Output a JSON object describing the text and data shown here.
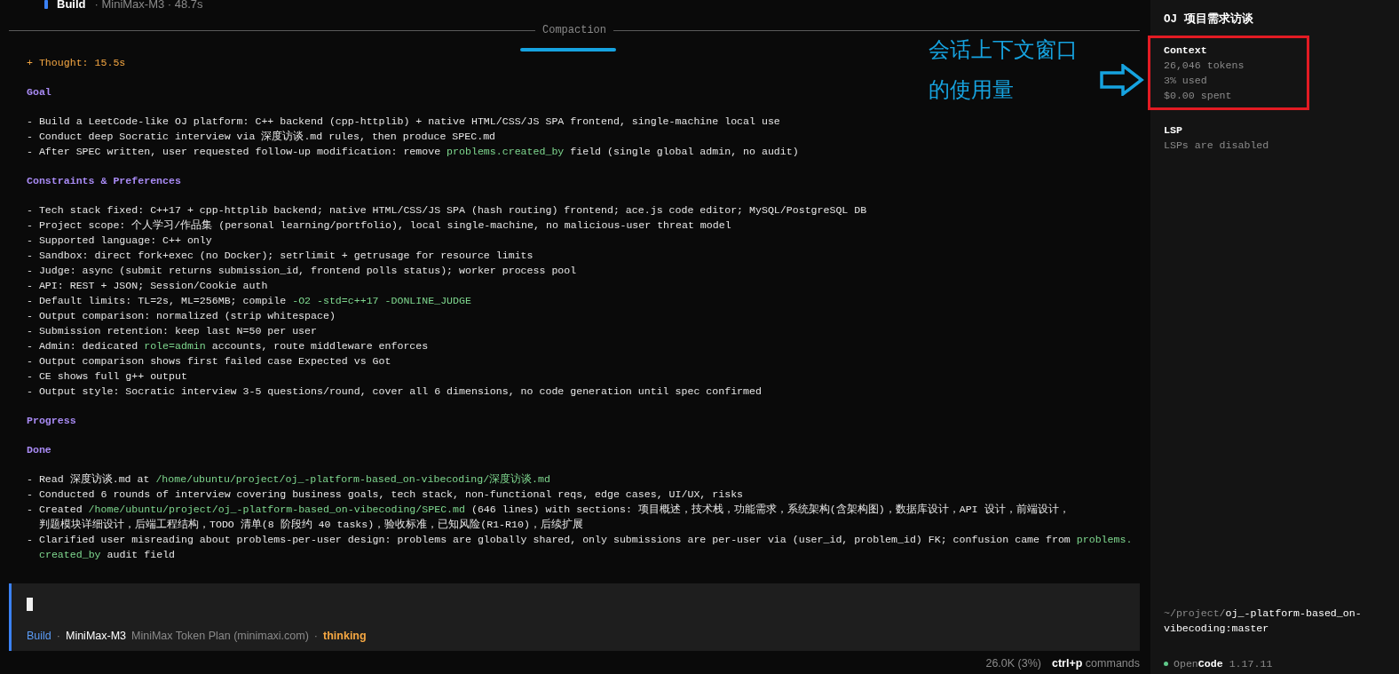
{
  "header": {
    "agent": "Build",
    "detail": "· MiniMax-M3 · 48.7s"
  },
  "divider_label": "Compaction",
  "blocks": [
    {
      "kind": "thought",
      "text": "+ Thought: 15.5s"
    },
    {
      "kind": "heading",
      "text": "Goal"
    },
    {
      "kind": "bullets",
      "items": [
        {
          "lines": [
            [
              {
                "kind": "plain",
                "text": "- Build a LeetCode-like OJ platform: C++ backend (cpp-httplib) + native HTML/CSS/JS SPA frontend, single-machine local use"
              }
            ]
          ]
        },
        {
          "lines": [
            [
              {
                "kind": "plain",
                "text": "- Conduct deep Socratic interview via 深度访谈.md rules, then produce SPEC.md"
              }
            ]
          ]
        },
        {
          "lines": [
            [
              {
                "kind": "plain",
                "text": "- After SPEC written, user requested follow-up modification: remove "
              },
              {
                "kind": "code",
                "text": "problems.created_by"
              },
              {
                "kind": "plain",
                "text": " field (single global admin, no audit)"
              }
            ]
          ]
        }
      ]
    },
    {
      "kind": "heading",
      "text": "Constraints & Preferences"
    },
    {
      "kind": "bullets",
      "items": [
        {
          "lines": [
            [
              {
                "kind": "plain",
                "text": "- Tech stack fixed: C++17 + cpp-httplib backend; native HTML/CSS/JS SPA (hash routing) frontend; ace.js code editor; MySQL/PostgreSQL DB"
              }
            ]
          ]
        },
        {
          "lines": [
            [
              {
                "kind": "plain",
                "text": "- Project scope: 个人学习/作品集 (personal learning/portfolio), local single-machine, no malicious-user threat model"
              }
            ]
          ]
        },
        {
          "lines": [
            [
              {
                "kind": "plain",
                "text": "- Supported language: C++ only"
              }
            ]
          ]
        },
        {
          "lines": [
            [
              {
                "kind": "plain",
                "text": "- Sandbox: direct fork+exec (no Docker); setrlimit + getrusage for resource limits"
              }
            ]
          ]
        },
        {
          "lines": [
            [
              {
                "kind": "plain",
                "text": "- Judge: async (submit returns submission_id, frontend polls status); worker process pool"
              }
            ]
          ]
        },
        {
          "lines": [
            [
              {
                "kind": "plain",
                "text": "- API: REST + JSON; Session/Cookie auth"
              }
            ]
          ]
        },
        {
          "lines": [
            [
              {
                "kind": "plain",
                "text": "- Default limits: TL=2s, ML=256MB; compile "
              },
              {
                "kind": "code",
                "text": "-O2 -std=c++17 -DONLINE_JUDGE"
              }
            ]
          ]
        },
        {
          "lines": [
            [
              {
                "kind": "plain",
                "text": "- Output comparison: normalized (strip whitespace)"
              }
            ]
          ]
        },
        {
          "lines": [
            [
              {
                "kind": "plain",
                "text": "- Submission retention: keep last N=50 per user"
              }
            ]
          ]
        },
        {
          "lines": [
            [
              {
                "kind": "plain",
                "text": "- Admin: dedicated "
              },
              {
                "kind": "code",
                "text": "role=admin"
              },
              {
                "kind": "plain",
                "text": " accounts, route middleware enforces"
              }
            ]
          ]
        },
        {
          "lines": [
            [
              {
                "kind": "plain",
                "text": "- Output comparison shows first failed case Expected vs Got"
              }
            ]
          ]
        },
        {
          "lines": [
            [
              {
                "kind": "plain",
                "text": "- CE shows full g++ output"
              }
            ]
          ]
        },
        {
          "lines": [
            [
              {
                "kind": "plain",
                "text": "- Output style: Socratic interview 3-5 questions/round, cover all 6 dimensions, no code generation until spec confirmed"
              }
            ]
          ]
        }
      ]
    },
    {
      "kind": "heading",
      "text": "Progress"
    },
    {
      "kind": "heading",
      "text": "Done"
    },
    {
      "kind": "bullets",
      "items": [
        {
          "lines": [
            [
              {
                "kind": "plain",
                "text": "- Read 深度访谈.md at "
              },
              {
                "kind": "code",
                "text": "/home/ubuntu/project/oj_-platform-based_on-vibecoding/深度访谈.md"
              }
            ]
          ]
        },
        {
          "lines": [
            [
              {
                "kind": "plain",
                "text": "- Conducted 6 rounds of interview covering business goals, tech stack, non-functional reqs, edge cases, UI/UX, risks"
              }
            ]
          ]
        },
        {
          "lines": [
            [
              {
                "kind": "plain",
                "text": "- Created "
              },
              {
                "kind": "code",
                "text": "/home/ubuntu/project/oj_-platform-based_on-vibecoding/SPEC.md"
              },
              {
                "kind": "plain",
                "text": " (646 lines) with sections: 项目概述，技术栈，功能需求，系统架构(含架构图)，数据库设计，API 设计，前端设计，"
              }
            ],
            [
              {
                "kind": "plain",
                "text": "判题模块详细设计，后端工程结构，TODO 清单(8 阶段约 40 tasks)，验收标准，已知风险(R1-R10)，后续扩展"
              }
            ]
          ]
        },
        {
          "lines": [
            [
              {
                "kind": "plain",
                "text": "- Clarified user misreading about problems-per-user design: problems are globally shared, only submissions are per-user via (user_id, problem_id) FK; confusion came from "
              },
              {
                "kind": "code",
                "text": "problems."
              }
            ],
            [
              {
                "kind": "code",
                "text": "created_by"
              },
              {
                "kind": "plain",
                "text": " audit field"
              }
            ]
          ]
        }
      ]
    }
  ],
  "input": {
    "mode": "Build",
    "sep1": "·",
    "model": "MiniMax-M3",
    "provider": "MiniMax Token Plan (minimaxi.com)",
    "sep2": "·",
    "status": "thinking"
  },
  "status_bar": {
    "usage": "26.0K (3%)",
    "shortcut": "ctrl+p",
    "shortcut_label": "commands"
  },
  "sidebar": {
    "title": "OJ 项目需求访谈",
    "sections": [
      {
        "heading": "Context",
        "lines": [
          "26,046 tokens",
          "3% used",
          "$0.00 spent"
        ],
        "highlighted": true
      },
      {
        "heading": "LSP",
        "lines": [
          "LSPs are disabled"
        ],
        "highlighted": false
      }
    ],
    "path_prefix": "~/project/",
    "path_lines": [
      "oj_-platform-based_on-",
      "vibecoding:master"
    ],
    "version": {
      "name_dim": "Open",
      "name_bold": "Code",
      "number": "1.17.11"
    }
  },
  "annotation": {
    "lines": [
      "会话上下文窗口",
      "的使用量"
    ]
  }
}
